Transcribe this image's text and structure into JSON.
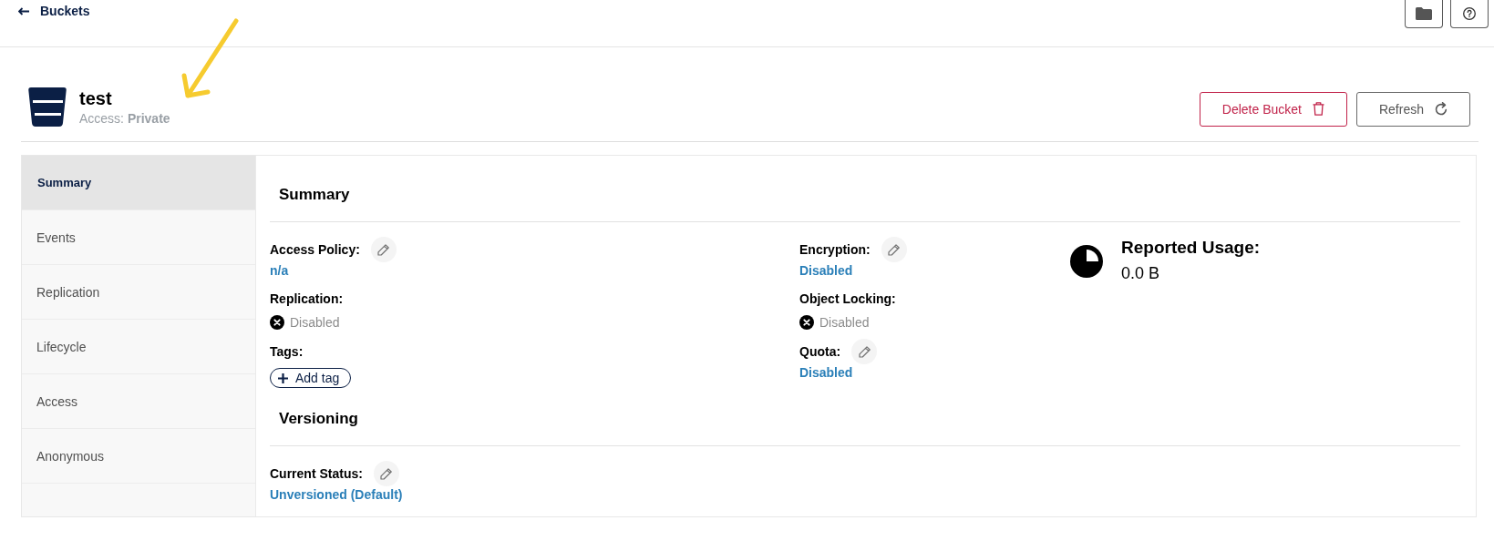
{
  "top_bar": {
    "back_link": "Buckets"
  },
  "header": {
    "title": "test",
    "access": "Access: **Private**",
    "buttons": [
      {
        "label": "Delete Bucket",
        "kind": "danger"
      },
      {
        "label": "Refresh",
        "kind": "refresh"
      }
    ]
  },
  "sidebar": {
    "items": [
      {
        "label": "Summary",
        "selected": true
      },
      {
        "label": "Events",
        "selected": false
      },
      {
        "label": "Replication",
        "selected": false
      },
      {
        "label": "Lifecycle",
        "selected": false
      },
      {
        "label": "Access",
        "selected": false
      },
      {
        "label": "Anonymous",
        "selected": false
      }
    ]
  },
  "summary": {
    "title": "Summary",
    "columns": [
      {
        "fields": [
          {
            "label": "Access Policy:",
            "editable": true,
            "kind": "link",
            "value": "n/a"
          },
          {
            "label": "Replication:",
            "editable": false,
            "kind": "status",
            "on": false,
            "value": "Disabled"
          },
          {
            "label": "Tags:",
            "editable": false,
            "kind": "tags",
            "add_label": "Add tag"
          }
        ]
      },
      {
        "fields": [
          {
            "label": "Encryption:",
            "editable": true,
            "kind": "link",
            "value": "Disabled"
          },
          {
            "label": "Object Locking:",
            "editable": false,
            "kind": "status",
            "on": false,
            "value": "Disabled"
          },
          {
            "label": "Quota:",
            "editable": true,
            "kind": "link",
            "value": "Disabled"
          }
        ]
      }
    ],
    "usage": {
      "label": "Reported Usage:",
      "value": "0.0 B"
    }
  },
  "versioning": {
    "title": "Versioning",
    "fields": [
      {
        "label": "Current Status:",
        "editable": true,
        "kind": "link",
        "value": "Unversioned (Default)"
      }
    ]
  }
}
